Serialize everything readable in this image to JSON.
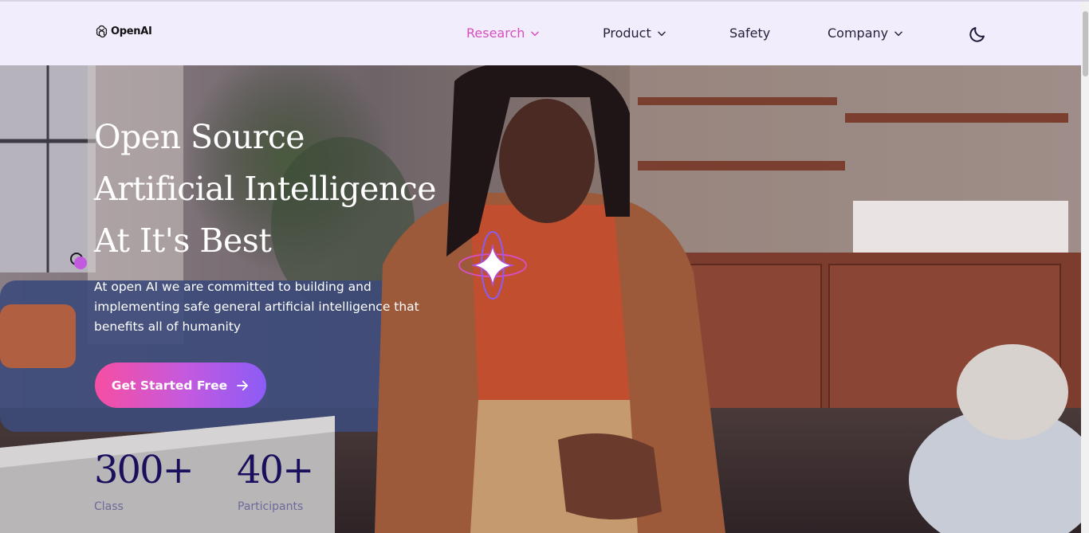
{
  "header": {
    "logo_text": "OpenAI",
    "nav": [
      {
        "label": "Research",
        "active": true,
        "dropdown": true
      },
      {
        "label": "Product",
        "dropdown": true
      },
      {
        "label": "Safety",
        "dropdown": false
      },
      {
        "label": "Company",
        "dropdown": true
      }
    ],
    "theme_icon": "moon-icon"
  },
  "hero": {
    "headline": [
      "Open Source",
      "Artificial Intelligence",
      "At It's Best"
    ],
    "description": "At open AI we are committed to building and implementing safe general artificial intelligence that benefits all of humanity",
    "cta_label": "Get Started Free",
    "stats": [
      {
        "value": "300+",
        "label": "Class"
      },
      {
        "value": "40+",
        "label": "Participants"
      }
    ]
  },
  "colors": {
    "accent": "#d64fbd",
    "cta_gradient_start": "#f74ea2",
    "cta_gradient_end": "#8b5cf6",
    "stat_color": "#1a0f5c",
    "nav_bg": "#f2edfc"
  }
}
